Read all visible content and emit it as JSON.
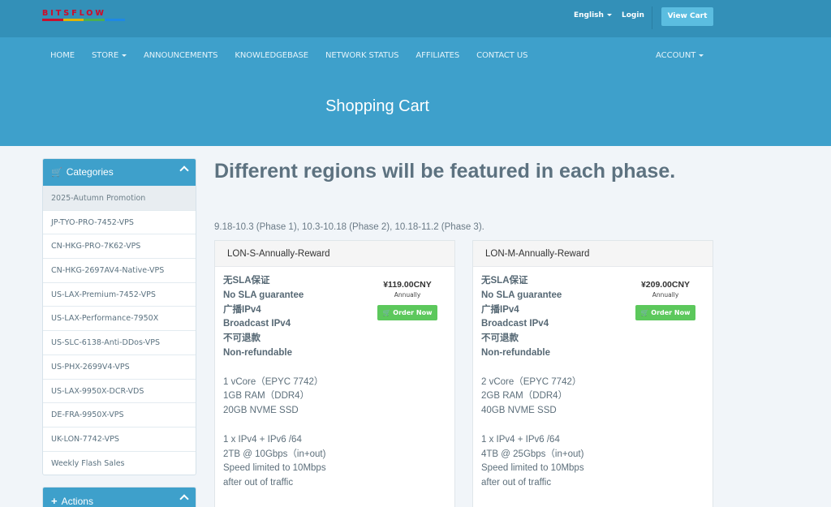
{
  "header": {
    "logo_text": "BITSFLOW",
    "logo_bar_colors": [
      "#c8102e",
      "#e2b400",
      "#4caf50",
      "#1e88e5"
    ],
    "language": "English",
    "login": "Login",
    "view_cart": "View Cart"
  },
  "nav": {
    "items": [
      "HOME",
      "STORE",
      "ANNOUNCEMENTS",
      "KNOWLEDGEBASE",
      "NETWORK STATUS",
      "AFFILIATES",
      "CONTACT US"
    ],
    "account": "ACCOUNT"
  },
  "hero": {
    "title": "Shopping Cart"
  },
  "sidebar": {
    "categories_title": "Categories",
    "categories": [
      "2025-Autumn Promotion",
      "JP-TYO-PRO-7452-VPS",
      "CN-HKG-PRO-7K62-VPS",
      "CN-HKG-2697AV4-Native-VPS",
      "US-LAX-Premium-7452-VPS",
      "US-LAX-Performance-7950X",
      "US-SLC-6138-Anti-DDos-VPS",
      "US-PHX-2699V4-VPS",
      "US-LAX-9950X-DCR-VDS",
      "DE-FRA-9950X-VPS",
      "UK-LON-7742-VPS",
      "Weekly Flash Sales"
    ],
    "actions_title": "Actions"
  },
  "main": {
    "title": "Different regions will be featured in each phase.",
    "phase_text": "9.18-10.3 (Phase 1), 10.3-10.18 (Phase 2), 10.18-11.2 (Phase 3)."
  },
  "products": [
    {
      "name": "LON-S-Annually-Reward",
      "price": "¥119.00CNY",
      "cycle": "Annually",
      "order_label": "Order Now",
      "bold_lines": [
        "无SLA保证",
        "No SLA guarantee",
        "广播IPv4",
        "Broadcast IPv4",
        "不可退款",
        "Non-refundable"
      ],
      "spec_lines": [
        "1 vCore（EPYC 7742）",
        "1GB RAM（DDR4）",
        "20GB NVME SSD"
      ],
      "net_lines": [
        "1 x IPv4 + IPv6 /64",
        "2TB @ 10Gbps（in+out)",
        "Speed limited to 10Mbps",
        "after out of traffic"
      ]
    },
    {
      "name": "LON-M-Annually-Reward",
      "price": "¥209.00CNY",
      "cycle": "Annually",
      "order_label": "Order Now",
      "bold_lines": [
        "无SLA保证",
        "No SLA guarantee",
        "广播IPv4",
        "Broadcast IPv4",
        "不可退款",
        "Non-refundable"
      ],
      "spec_lines": [
        "2 vCore（EPYC 7742）",
        "2GB RAM（DDR4）",
        "40GB NVME SSD"
      ],
      "net_lines": [
        "1 x IPv4 + IPv6 /64",
        "4TB @ 25Gbps（in+out)",
        "Speed limited to 10Mbps",
        "after out of traffic"
      ]
    }
  ]
}
